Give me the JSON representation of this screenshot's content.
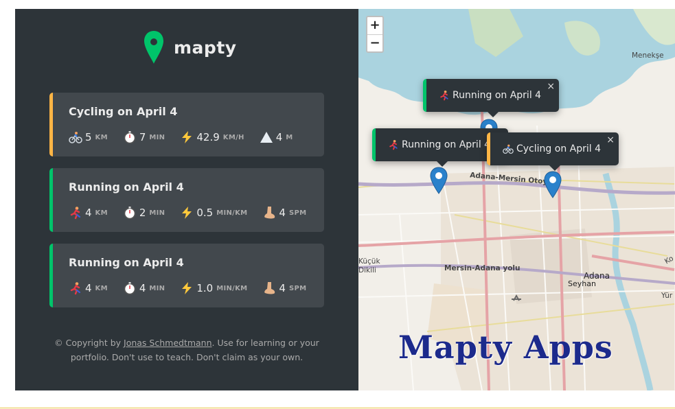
{
  "app": {
    "logo_text": "mapty"
  },
  "workouts": [
    {
      "title": "Cycling on April 4",
      "type": "cycling",
      "stats": [
        {
          "icon": "bike-icon",
          "value": "5",
          "unit": "KM"
        },
        {
          "icon": "stopwatch-icon",
          "value": "7",
          "unit": "MIN"
        },
        {
          "icon": "lightning-icon",
          "value": "42.9",
          "unit": "KM/H"
        },
        {
          "icon": "mountain-icon",
          "value": "4",
          "unit": "M"
        }
      ]
    },
    {
      "title": "Running on April 4",
      "type": "running",
      "stats": [
        {
          "icon": "runner-icon",
          "value": "4",
          "unit": "KM"
        },
        {
          "icon": "stopwatch-icon",
          "value": "2",
          "unit": "MIN"
        },
        {
          "icon": "lightning-icon",
          "value": "0.5",
          "unit": "MIN/KM"
        },
        {
          "icon": "foot-icon",
          "value": "4",
          "unit": "SPM"
        }
      ]
    },
    {
      "title": "Running on April 4",
      "type": "running",
      "stats": [
        {
          "icon": "runner-icon",
          "value": "4",
          "unit": "KM"
        },
        {
          "icon": "stopwatch-icon",
          "value": "4",
          "unit": "MIN"
        },
        {
          "icon": "lightning-icon",
          "value": "1.0",
          "unit": "MIN/KM"
        },
        {
          "icon": "foot-icon",
          "value": "4",
          "unit": "SPM"
        }
      ]
    }
  ],
  "copyright": {
    "prefix": "© Copyright by ",
    "link_text": "Jonas Schmedtmann",
    "suffix": ". Use for learning or your portfolio. Don't use to teach. Don't claim as your own."
  },
  "map": {
    "zoom_in": "+",
    "zoom_out": "−",
    "popups": [
      {
        "label": "Running on April 4",
        "type": "running",
        "close": "×"
      },
      {
        "label": "Running on April 4",
        "type": "running",
        "close": "×"
      },
      {
        "label": "Cycling on April 4",
        "type": "cycling",
        "close": "×"
      }
    ],
    "labels": {
      "menekse": "Menekşe",
      "highway": "Adana-Mersin Otoyolu",
      "road": "Mersin-Adana yolu",
      "kucuk": "Küçük",
      "dikili": "Dikili",
      "adana": "Adana",
      "seyhan": "Seyhan",
      "yur": "Yür",
      "ko": "Ko"
    }
  },
  "watermark": "Mapty Apps",
  "colors": {
    "running": "#00c46a",
    "cycling": "#ffb545",
    "sidebar": "#2d3439",
    "card": "#42484d"
  }
}
